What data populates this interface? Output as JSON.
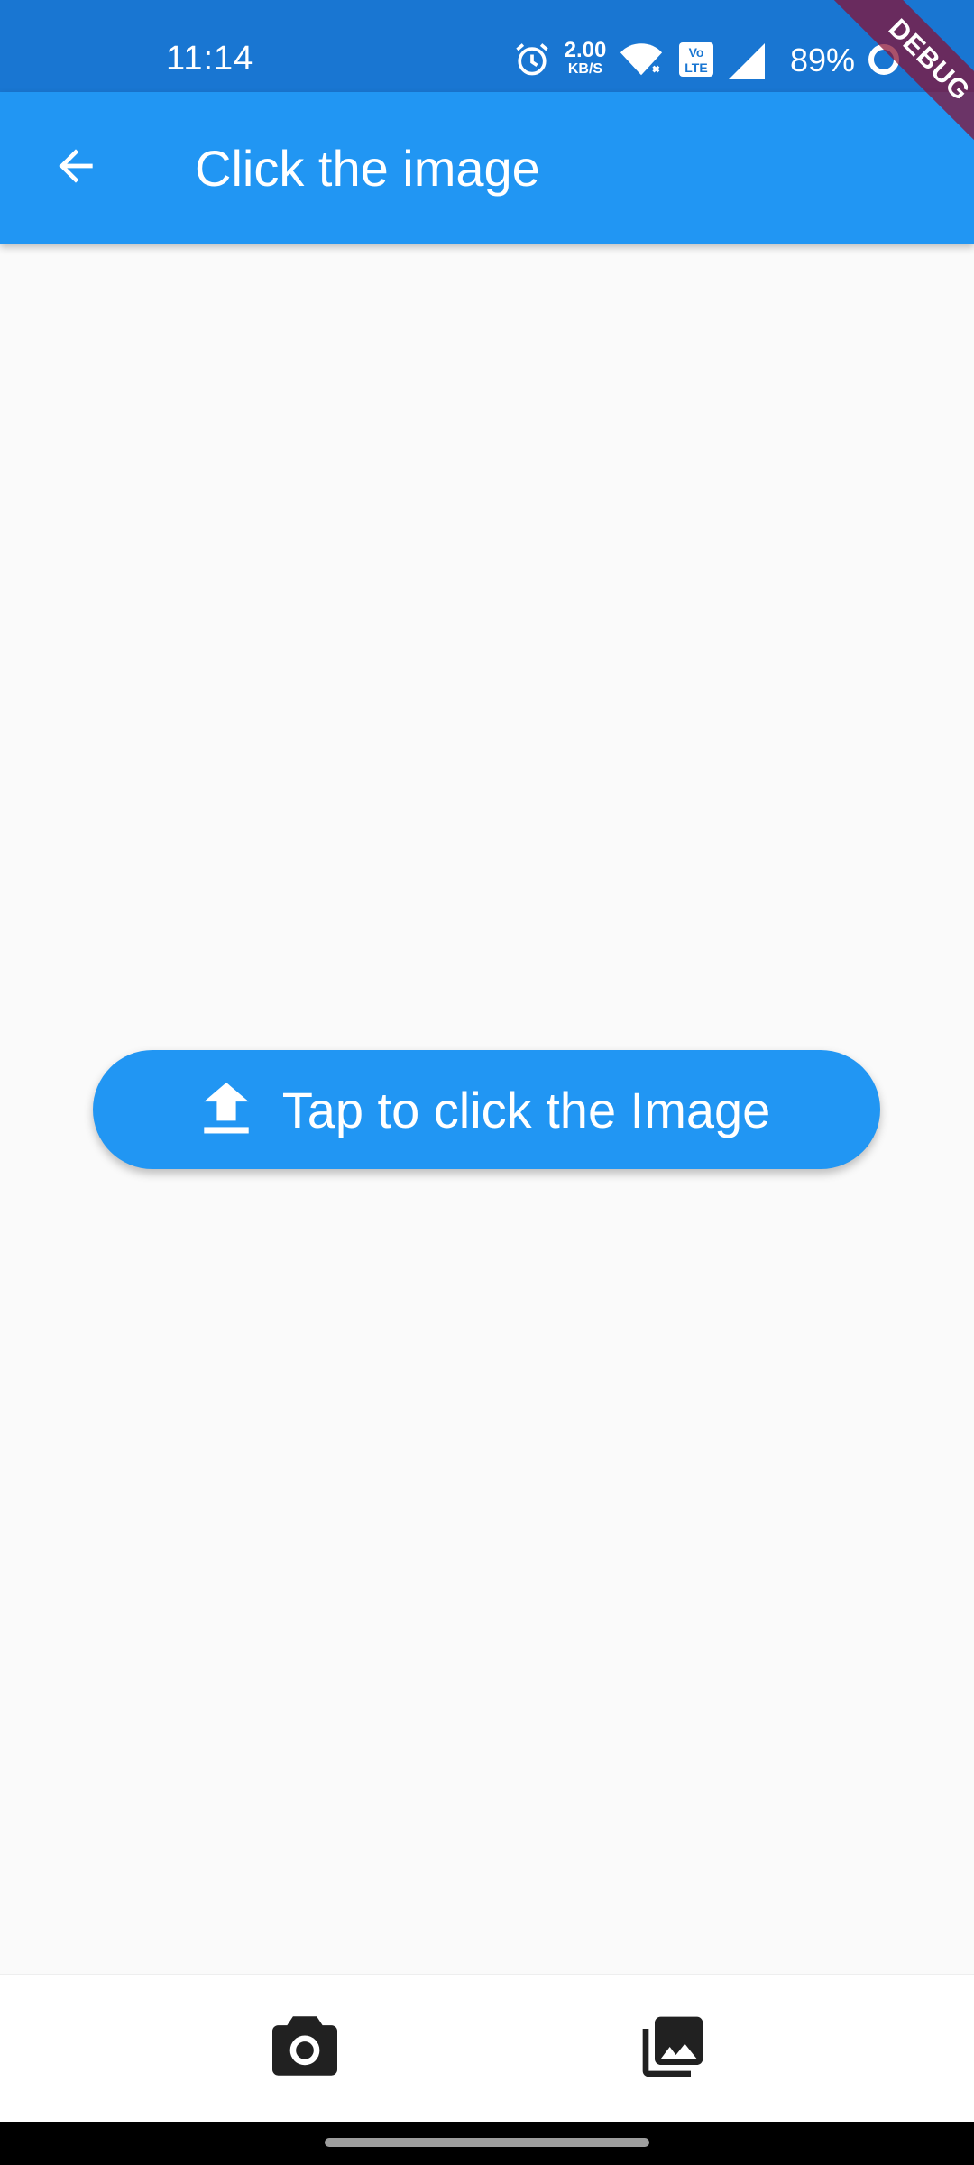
{
  "status_bar": {
    "time": "11:14",
    "net_speed_value": "2.00",
    "net_speed_unit": "KB/S",
    "volte_label": "Vo LTE",
    "battery": "89%",
    "icons": [
      "alarm-icon",
      "wifi-icon",
      "volte-icon",
      "signal-icon",
      "battery-ring-icon"
    ]
  },
  "debug_banner": "DEBUG",
  "app_bar": {
    "back_icon": "arrow-back-icon",
    "title": "Click the image",
    "color": "#2196f3"
  },
  "main": {
    "button_label": "Tap to click the Image",
    "button_icon": "upload-icon"
  },
  "bottom_bar": {
    "camera_icon": "camera-icon",
    "gallery_icon": "photo-library-icon"
  },
  "colors": {
    "status_bar": "#1976d2",
    "accent": "#2196f3",
    "background": "#fafafa",
    "icon_dark": "#212121"
  }
}
